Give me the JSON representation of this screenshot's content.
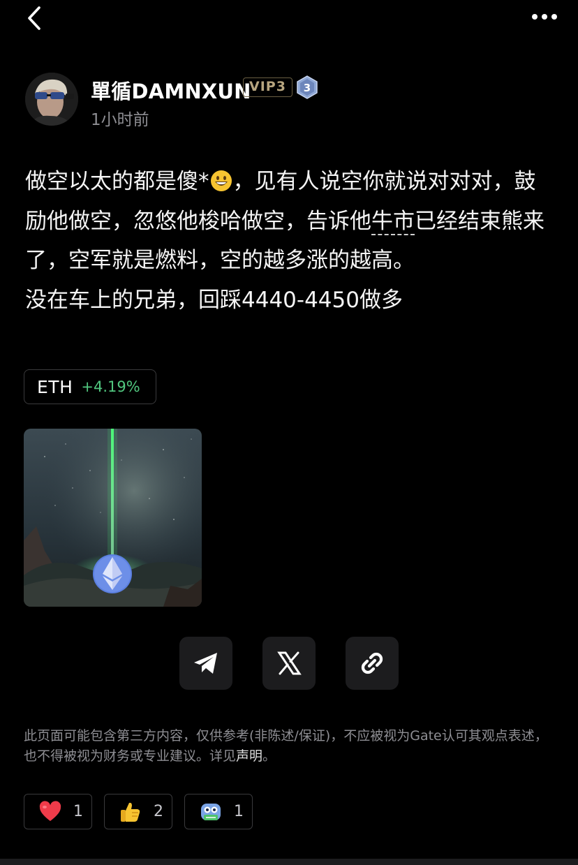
{
  "topbar": {
    "back_icon": "chevron-left-icon",
    "more_icon": "more-horizontal-icon"
  },
  "author": {
    "name": "單循DAMNXUN",
    "vip": "VIP3",
    "level": "3",
    "time": "1小时前"
  },
  "post": {
    "line1a": "做空以太的都是傻*",
    "line1b": "，见有人说空你就说对对对，鼓励他做空，忽悠他梭哈做空，告诉他",
    "link_text": "牛市",
    "line1c": "已经结束熊来了，空军就是燃料，空的越多涨的越高。",
    "line2": "没在车上的兄弟，回踩4440-4450做多"
  },
  "ticker": {
    "symbol": "ETH",
    "change": "+4.19%",
    "change_color": "#51c77f"
  },
  "share": {
    "telegram_icon": "telegram-icon",
    "x_icon": "x-icon",
    "link_icon": "link-icon"
  },
  "disclaimer": {
    "text": "此页面可能包含第三方内容，仅供参考(非陈述/保证)，不应被视为Gate认可其观点表述，也不得被视为财务或专业建议。详见",
    "link": "声明",
    "end": "。"
  },
  "reactions": [
    {
      "icon": "heart-icon",
      "count": "1"
    },
    {
      "icon": "thumbs-up-icon",
      "count": "2"
    },
    {
      "icon": "hodl-robot-icon",
      "count": "1"
    }
  ],
  "colors": {
    "accent_green": "#51c77f",
    "background": "#000000",
    "muted": "#8e8e93"
  }
}
